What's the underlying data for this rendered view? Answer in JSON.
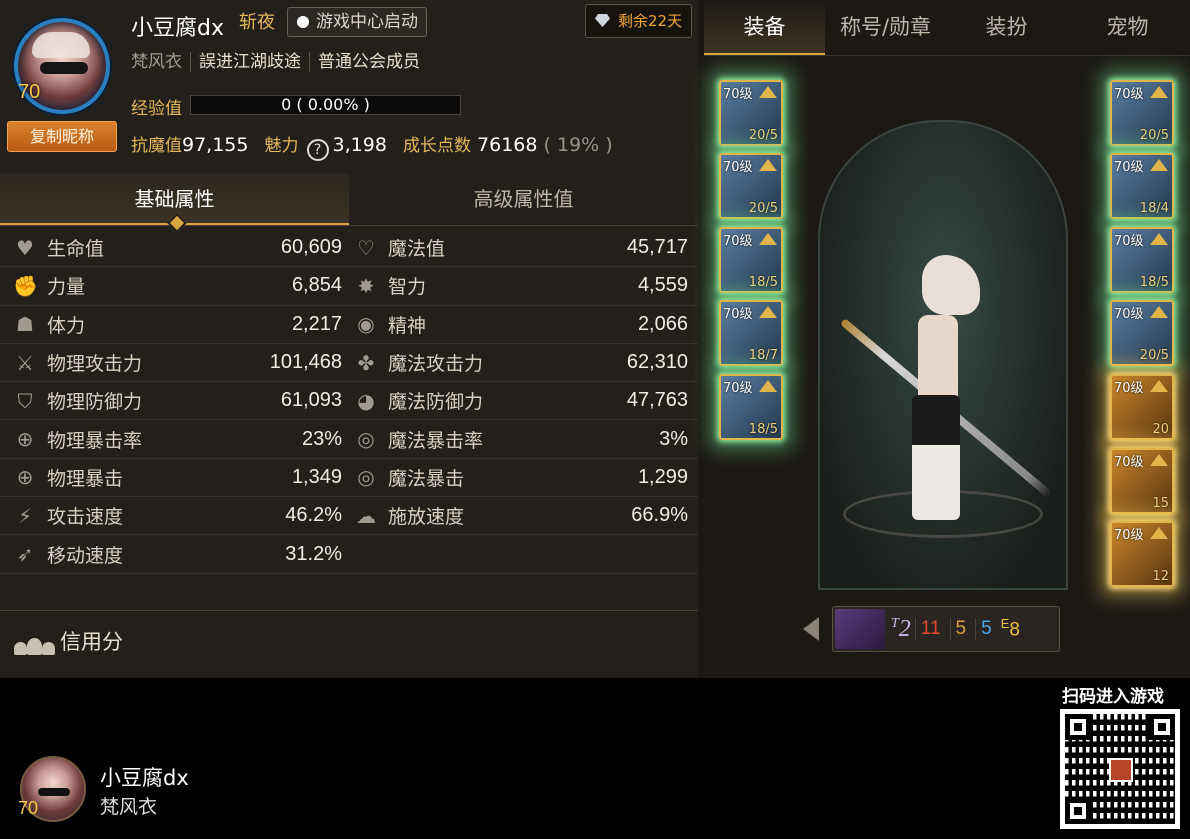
{
  "profile": {
    "name": "小豆腐dx",
    "title": "斩夜",
    "level": "70",
    "copy_button": "复制昵称",
    "game_center_button": "游戏中心启动",
    "remaining": "剩余22天",
    "class": "梵风衣",
    "guild": "誤进江湖歧途",
    "guild_role": "普通公会成员",
    "exp_label": "经验值",
    "exp_text": "0 ( 0.00% )",
    "exp_fraction": 0,
    "resist_label": "抗魔值",
    "resist_value": "97,155",
    "charm_label": "魅力",
    "charm_value": "3,198",
    "growth_label": "成长点数",
    "growth_value": "76168",
    "growth_pct": "( 19% )"
  },
  "attr_tabs": [
    "基础属性",
    "高级属性值"
  ],
  "stats": [
    {
      "left": {
        "icon": "heart-icon",
        "glyph": "♥",
        "label": "生命值",
        "value": "60,609"
      },
      "right": {
        "icon": "heart-outline-icon",
        "glyph": "♡",
        "label": "魔法值",
        "value": "45,717"
      }
    },
    {
      "left": {
        "icon": "fist-icon",
        "glyph": "✊",
        "label": "力量",
        "value": "6,854"
      },
      "right": {
        "icon": "burst-icon",
        "glyph": "✸",
        "label": "智力",
        "value": "4,559"
      }
    },
    {
      "left": {
        "icon": "body-icon",
        "glyph": "☗",
        "label": "体力",
        "value": "2,217"
      },
      "right": {
        "icon": "spirit-icon",
        "glyph": "◉",
        "label": "精神",
        "value": "2,066"
      }
    },
    {
      "left": {
        "icon": "sword-icon",
        "glyph": "⚔",
        "label": "物理攻击力",
        "value": "101,468"
      },
      "right": {
        "icon": "magic-star-icon",
        "glyph": "✤",
        "label": "魔法攻击力",
        "value": "62,310"
      }
    },
    {
      "left": {
        "icon": "shield-icon",
        "glyph": "⛉",
        "label": "物理防御力",
        "value": "61,093"
      },
      "right": {
        "icon": "orb-icon",
        "glyph": "◕",
        "label": "魔法防御力",
        "value": "47,763"
      }
    },
    {
      "left": {
        "icon": "crosshair-icon",
        "glyph": "⊕",
        "label": "物理暴击率",
        "value": "23%"
      },
      "right": {
        "icon": "target-icon",
        "glyph": "◎",
        "label": "魔法暴击率",
        "value": "3%"
      }
    },
    {
      "left": {
        "icon": "crosshair-icon",
        "glyph": "⊕",
        "label": "物理暴击",
        "value": "1,349"
      },
      "right": {
        "icon": "target-icon",
        "glyph": "◎",
        "label": "魔法暴击",
        "value": "1,299"
      }
    },
    {
      "left": {
        "icon": "attack-speed-icon",
        "glyph": "⚡",
        "label": "攻击速度",
        "value": "46.2%"
      },
      "right": {
        "icon": "cast-speed-icon",
        "glyph": "☁",
        "label": "施放速度",
        "value": "66.9%"
      }
    },
    {
      "left": {
        "icon": "boot-icon",
        "glyph": "➶",
        "label": "移动速度",
        "value": "31.2%"
      },
      "right": null
    }
  ],
  "credit_label": "信用分",
  "right_tabs": [
    "装备",
    "称号/勋章",
    "装扮",
    "宠物"
  ],
  "equipment_left": [
    {
      "level": "70级",
      "grade": "20/5"
    },
    {
      "level": "70级",
      "grade": "20/5"
    },
    {
      "level": "70级",
      "grade": "18/5"
    },
    {
      "level": "70级",
      "grade": "18/7"
    },
    {
      "level": "70级",
      "grade": "18/5"
    }
  ],
  "equipment_right": [
    {
      "level": "70级",
      "grade": "20/5",
      "style": "green"
    },
    {
      "level": "70级",
      "grade": "18/4",
      "style": "green"
    },
    {
      "level": "70级",
      "grade": "18/5",
      "style": "green"
    },
    {
      "level": "70级",
      "grade": "20/5",
      "style": "green"
    },
    {
      "level": "70级",
      "grade": "20",
      "style": "gold"
    },
    {
      "level": "70级",
      "grade": "15",
      "style": "gold"
    },
    {
      "level": "70级",
      "grade": "12",
      "style": "gold"
    }
  ],
  "pet": {
    "tier": "2",
    "n1": "11",
    "n2": "5",
    "n3": "5",
    "e": "8",
    "n1_color": "#e04a2a",
    "n2_color": "#d8a040",
    "n3_color": "#4aa6e8"
  },
  "footer": {
    "name": "小豆腐dx",
    "class": "梵风衣",
    "level": "70",
    "qr_label": "扫码进入游戏"
  },
  "colors": {
    "accent": "#d8a540",
    "panel": "#231f1a",
    "gold_text": "#e6b85a"
  }
}
